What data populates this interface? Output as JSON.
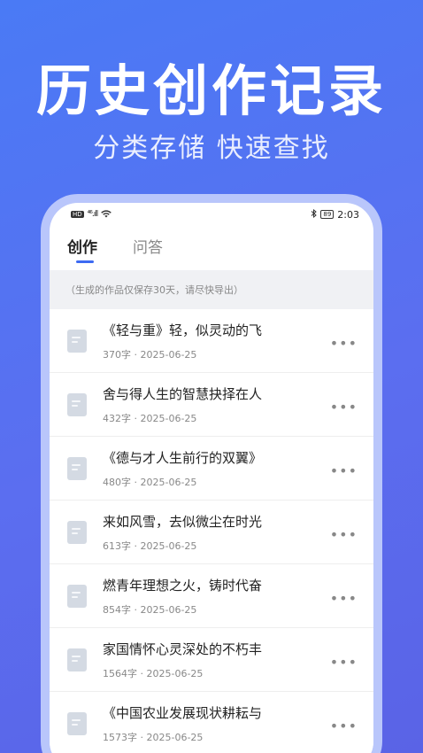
{
  "hero": {
    "title": "历史创作记录",
    "subtitle": "分类存储 快速查找"
  },
  "status_bar": {
    "hd": "HD",
    "signal": "⁴⁶.ıll",
    "battery": "89",
    "time": "2:03"
  },
  "tabs": [
    {
      "label": "创作"
    },
    {
      "label": "问答"
    }
  ],
  "notice": "（生成的作品仅保存30天，请尽快导出）",
  "items": [
    {
      "title": "《轻与重》轻，似灵动的飞",
      "meta": "370字 · 2025-06-25",
      "more": "•••"
    },
    {
      "title": "舍与得人生的智慧抉择在人",
      "meta": "432字 · 2025-06-25",
      "more": "•••"
    },
    {
      "title": "《德与才人生前行的双翼》",
      "meta": "480字 · 2025-06-25",
      "more": "•••"
    },
    {
      "title": "来如风雪，去似微尘在时光",
      "meta": "613字 · 2025-06-25",
      "more": "•••"
    },
    {
      "title": "燃青年理想之火，铸时代奋",
      "meta": "854字 · 2025-06-25",
      "more": "•••"
    },
    {
      "title": "家国情怀心灵深处的不朽丰",
      "meta": "1564字 · 2025-06-25",
      "more": "•••"
    },
    {
      "title": "《中国农业发展现状耕耘与",
      "meta": "1573字 · 2025-06-25",
      "more": "•••"
    }
  ]
}
